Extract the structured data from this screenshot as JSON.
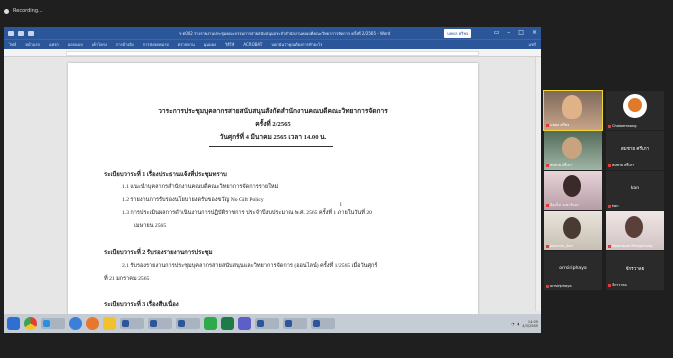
{
  "recording": {
    "label": "Recording..."
  },
  "word": {
    "window_title": "ร-ต002 ร่างรายงานประชุมคณะกรรมการสายสนับสนุนประจำสำนักงานคณบดีคณะวิทยาการจัดการ ครั้งที่ 2/2565 - Word",
    "signin_label": "นพดล ศรีพจ",
    "menu": [
      "ไฟล์",
      "หน้าแรก",
      "แทรก",
      "ออกแบบ",
      "เค้าโครง",
      "การอ้างอิง",
      "การส่งจดหมาย",
      "ตรวจทาน",
      "มุมมอง",
      "วิธีใช้",
      "ACROBAT",
      "บอกฉันว่าคุณต้องการทำอะไร"
    ],
    "share_label": "แชร์",
    "document": {
      "title_line1": "วาระการประชุมบุคลากรสายสนับสนุนสังกัดสำนักงานคณบดีคณะวิทยาการจัดการ",
      "title_line2": "ครั้งที่ 2/2565",
      "title_line3": "วันศุกร์ที่ 4 มีนาคม 2565 เวลา 14.00 น.",
      "agenda1": "ระเบียบวาระที่ 1 เรื่องประธานแจ้งที่ประชุมทราบ",
      "item1_1": "1.1 แนะนำบุคลากรสำนักงานคณบดีคณะวิทยาการจัดการรายใหม่",
      "item1_2": "1.2 รายงานการรับรองนโยบายงดรับของขวัญ No Gift Policy",
      "item1_3a": "1.3 การประเมินผลการดำเนินงานการปฏิบัติราชการ ประจำปีงบประมาณ พ.ศ. 2565 ครั้งที่ 1 ภายในวันที่ 20",
      "item1_3b": "เมษายน 2565",
      "agenda2": "ระเบียบวาระที่ 2 รับรองรายงานการประชุม",
      "item2_1a": "2.1 รับรองรายงานการประชุมบุคลากรสายสนับสนุนและวิทยาการจัดการ (ออนไลน์) ครั้งที่ 1/2565 เมื่อวันศุกร์",
      "item2_1b": "ที่ 21 มกราคม 2565",
      "agenda3": "ระเบียบวาระที่ 3 เรื่องสืบเนื่อง",
      "cursor": "I"
    },
    "status_left": "หน้า 1 จาก 3",
    "zoom": "100%"
  },
  "taskbar": {
    "apps": [
      "windows",
      "chrome",
      "edge",
      "explorer",
      "app-orange",
      "app-yellow",
      "word",
      "excel",
      "teams"
    ],
    "time": "14:09",
    "date": "4/3/2565"
  },
  "participants": [
    {
      "name": "นพดล ศรีพจ",
      "video": true
    },
    {
      "name": "Chaloemsong",
      "video": false
    },
    {
      "name": "สมชาย ศรีเภา",
      "video": true
    },
    {
      "name": "สมชาย ศรีเภา",
      "video": false,
      "display": "สมชาย ศรีเภา"
    },
    {
      "name": "อ้อมไม่ ระตะวันนา",
      "video": true
    },
    {
      "name": "kan",
      "video": false,
      "display": "kan"
    },
    {
      "name": "Jasumin_Sari",
      "video": true
    },
    {
      "name": "Namnsom Mongkhong",
      "video": true
    },
    {
      "name": "orrsiriphaya",
      "video": false,
      "display": "orrsiriphaya"
    },
    {
      "name": "จักรวาลย",
      "video": false,
      "display": "จักรวาลย"
    }
  ]
}
